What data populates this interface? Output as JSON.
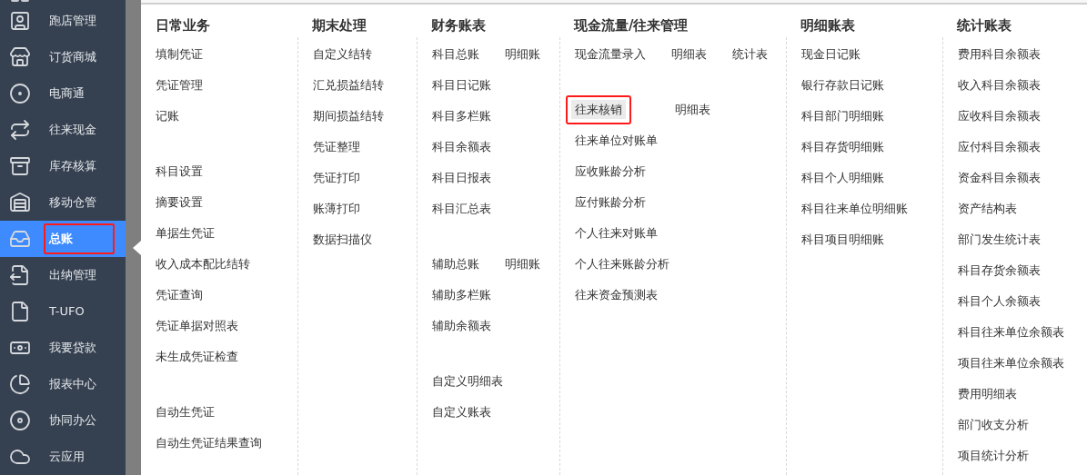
{
  "sidebar": {
    "items": [
      {
        "label": "跑店管理",
        "selected": false,
        "annotated": false
      },
      {
        "label": "订货商城",
        "selected": false,
        "annotated": false
      },
      {
        "label": "电商通",
        "selected": false,
        "annotated": false
      },
      {
        "label": "往来现金",
        "selected": false,
        "annotated": false
      },
      {
        "label": "库存核算",
        "selected": false,
        "annotated": false
      },
      {
        "label": "移动仓管",
        "selected": false,
        "annotated": false
      },
      {
        "label": "总账",
        "selected": true,
        "annotated": true
      },
      {
        "label": "出纳管理",
        "selected": false,
        "annotated": false
      },
      {
        "label": "T-UFO",
        "selected": false,
        "annotated": false
      },
      {
        "label": "我要贷款",
        "selected": false,
        "annotated": false
      },
      {
        "label": "报表中心",
        "selected": false,
        "annotated": false
      },
      {
        "label": "协同办公",
        "selected": false,
        "annotated": false
      },
      {
        "label": "云应用",
        "selected": false,
        "annotated": false
      }
    ]
  },
  "menu": {
    "columns": [
      {
        "heading": "日常业务",
        "groups": [
          [
            [
              {
                "label": "填制凭证",
                "selected": false,
                "annotated": false
              }
            ],
            [
              {
                "label": "凭证管理",
                "selected": false,
                "annotated": false
              }
            ],
            [
              {
                "label": "记账",
                "selected": false,
                "annotated": false
              }
            ]
          ],
          [
            [
              {
                "label": "科目设置",
                "selected": false,
                "annotated": false
              }
            ],
            [
              {
                "label": "摘要设置",
                "selected": false,
                "annotated": false
              }
            ],
            [
              {
                "label": "单据生凭证",
                "selected": false,
                "annotated": false
              }
            ],
            [
              {
                "label": "收入成本配比结转",
                "selected": false,
                "annotated": false
              }
            ],
            [
              {
                "label": "凭证查询",
                "selected": false,
                "annotated": false
              }
            ],
            [
              {
                "label": "凭证单据对照表",
                "selected": false,
                "annotated": false
              }
            ],
            [
              {
                "label": "未生成凭证检查",
                "selected": false,
                "annotated": false
              }
            ]
          ],
          [
            [
              {
                "label": "自动生凭证",
                "selected": false,
                "annotated": false
              }
            ],
            [
              {
                "label": "自动生凭证结果查询",
                "selected": false,
                "annotated": false
              }
            ]
          ]
        ]
      },
      {
        "heading": "期末处理",
        "groups": [
          [
            [
              {
                "label": "自定义结转",
                "selected": false,
                "annotated": false
              }
            ],
            [
              {
                "label": "汇兑损益结转",
                "selected": false,
                "annotated": false
              }
            ],
            [
              {
                "label": "期间损益结转",
                "selected": false,
                "annotated": false
              }
            ],
            [
              {
                "label": "凭证整理",
                "selected": false,
                "annotated": false
              }
            ],
            [
              {
                "label": "凭证打印",
                "selected": false,
                "annotated": false
              }
            ],
            [
              {
                "label": "账薄打印",
                "selected": false,
                "annotated": false
              }
            ],
            [
              {
                "label": "数据扫描仪",
                "selected": false,
                "annotated": false
              }
            ]
          ]
        ]
      },
      {
        "heading": "财务账表",
        "groups": [
          [
            [
              {
                "label": "科目总账",
                "selected": false,
                "annotated": false
              },
              {
                "label": "明细账",
                "selected": false,
                "annotated": false
              }
            ],
            [
              {
                "label": "科目日记账",
                "selected": false,
                "annotated": false
              }
            ],
            [
              {
                "label": "科目多栏账",
                "selected": false,
                "annotated": false
              }
            ],
            [
              {
                "label": "科目余额表",
                "selected": false,
                "annotated": false
              }
            ],
            [
              {
                "label": "科目日报表",
                "selected": false,
                "annotated": false
              }
            ],
            [
              {
                "label": "科目汇总表",
                "selected": false,
                "annotated": false
              }
            ]
          ],
          [
            [
              {
                "label": "辅助总账",
                "selected": false,
                "annotated": false
              },
              {
                "label": "明细账",
                "selected": false,
                "annotated": false
              }
            ],
            [
              {
                "label": "辅助多栏账",
                "selected": false,
                "annotated": false
              }
            ],
            [
              {
                "label": "辅助余额表",
                "selected": false,
                "annotated": false
              }
            ]
          ],
          [
            [
              {
                "label": "自定义明细表",
                "selected": false,
                "annotated": false
              }
            ],
            [
              {
                "label": "自定义账表",
                "selected": false,
                "annotated": false
              }
            ]
          ]
        ]
      },
      {
        "heading": "现金流量/往来管理",
        "groups": [
          [
            [
              {
                "label": "现金流量录入",
                "selected": false,
                "annotated": false
              },
              {
                "label": "明细表",
                "selected": false,
                "annotated": false
              },
              {
                "label": "统计表",
                "selected": false,
                "annotated": false
              }
            ]
          ],
          [
            [
              {
                "label": "往来核销",
                "selected": true,
                "annotated": true
              },
              {
                "label": "明细表",
                "selected": false,
                "annotated": false
              }
            ],
            [
              {
                "label": "往来单位对账单",
                "selected": false,
                "annotated": false
              }
            ],
            [
              {
                "label": "应收账龄分析",
                "selected": false,
                "annotated": false
              }
            ],
            [
              {
                "label": "应付账龄分析",
                "selected": false,
                "annotated": false
              }
            ],
            [
              {
                "label": "个人往来对账单",
                "selected": false,
                "annotated": false
              }
            ],
            [
              {
                "label": "个人往来账龄分析",
                "selected": false,
                "annotated": false
              }
            ],
            [
              {
                "label": "往来资金预测表",
                "selected": false,
                "annotated": false
              }
            ]
          ]
        ]
      },
      {
        "heading": "明细账表",
        "groups": [
          [
            [
              {
                "label": "现金日记账",
                "selected": false,
                "annotated": false
              }
            ],
            [
              {
                "label": "银行存款日记账",
                "selected": false,
                "annotated": false
              }
            ],
            [
              {
                "label": "科目部门明细账",
                "selected": false,
                "annotated": false
              }
            ],
            [
              {
                "label": "科目存货明细账",
                "selected": false,
                "annotated": false
              }
            ],
            [
              {
                "label": "科目个人明细账",
                "selected": false,
                "annotated": false
              }
            ],
            [
              {
                "label": "科目往来单位明细账",
                "selected": false,
                "annotated": false
              }
            ],
            [
              {
                "label": "科目项目明细账",
                "selected": false,
                "annotated": false
              }
            ]
          ]
        ]
      },
      {
        "heading": "统计账表",
        "groups": [
          [
            [
              {
                "label": "费用科目余额表",
                "selected": false,
                "annotated": false
              }
            ],
            [
              {
                "label": "收入科目余额表",
                "selected": false,
                "annotated": false
              }
            ],
            [
              {
                "label": "应收科目余额表",
                "selected": false,
                "annotated": false
              }
            ],
            [
              {
                "label": "应付科目余额表",
                "selected": false,
                "annotated": false
              }
            ],
            [
              {
                "label": "资金科目余额表",
                "selected": false,
                "annotated": false
              }
            ],
            [
              {
                "label": "资产结构表",
                "selected": false,
                "annotated": false
              }
            ],
            [
              {
                "label": "部门发生统计表",
                "selected": false,
                "annotated": false
              }
            ],
            [
              {
                "label": "科目存货余额表",
                "selected": false,
                "annotated": false
              }
            ],
            [
              {
                "label": "科目个人余额表",
                "selected": false,
                "annotated": false
              }
            ],
            [
              {
                "label": "科目往来单位余额表",
                "selected": false,
                "annotated": false
              }
            ],
            [
              {
                "label": "项目往来单位余额表",
                "selected": false,
                "annotated": false
              }
            ],
            [
              {
                "label": "费用明细表",
                "selected": false,
                "annotated": false
              }
            ],
            [
              {
                "label": "部门收支分析",
                "selected": false,
                "annotated": false
              }
            ],
            [
              {
                "label": "项目统计分析",
                "selected": false,
                "annotated": false
              }
            ]
          ]
        ]
      }
    ]
  }
}
